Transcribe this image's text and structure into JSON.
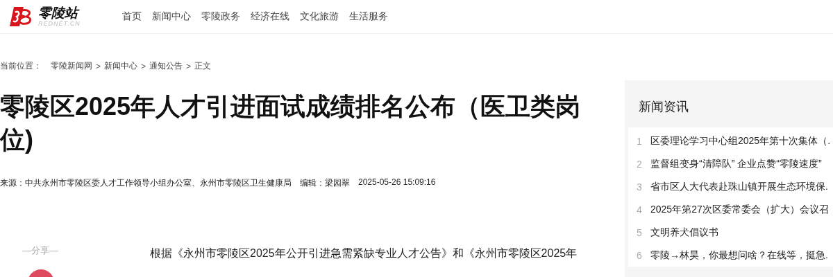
{
  "header": {
    "logo": {
      "name": "零陵站",
      "domain": "REDNET.CN"
    },
    "nav": [
      {
        "label": "首页"
      },
      {
        "label": "新闻中心"
      },
      {
        "label": "零陵政务"
      },
      {
        "label": "经济在线"
      },
      {
        "label": "文化旅游"
      },
      {
        "label": "生活服务"
      }
    ]
  },
  "breadcrumb": {
    "label": "当前位置：",
    "items": [
      "零陵新闻网",
      "新闻中心",
      "通知公告",
      "正文"
    ],
    "separator": ">"
  },
  "article": {
    "title": "零陵区2025年人才引进面试成绩排名公布（医卫类岗位)",
    "meta": [
      {
        "label": "来源：",
        "value": "中共永州市零陵区委人才工作领导小组办公室、永州市零陵区卫生健康局"
      },
      {
        "label": "编辑：",
        "value": "梁园翠"
      },
      {
        "value": "2025-05-26 15:09:16"
      }
    ],
    "share_label": "—分享—",
    "body": [
      "根据《永州市零陵区2025年公开引进急需紧缺专业人才公告》和《永州市零陵区2025年"
    ]
  },
  "sidebar": {
    "title": "新闻资讯",
    "items": [
      {
        "number": "1",
        "title": "区委理论学习中心组2025年第十次集体（."
      },
      {
        "number": "2",
        "title": "监督组变身“清障队” 企业点赞“零陵速度”"
      },
      {
        "number": "3",
        "title": "省市区人大代表赴珠山镇开展生态环境保."
      },
      {
        "number": "4",
        "title": "2025年第27次区委常委会（扩大）会议召"
      },
      {
        "number": "5",
        "title": "文明养犬倡议书"
      },
      {
        "number": "6",
        "title": "零陵→林昊，你最想问啥？在线等，挺急."
      }
    ]
  }
}
